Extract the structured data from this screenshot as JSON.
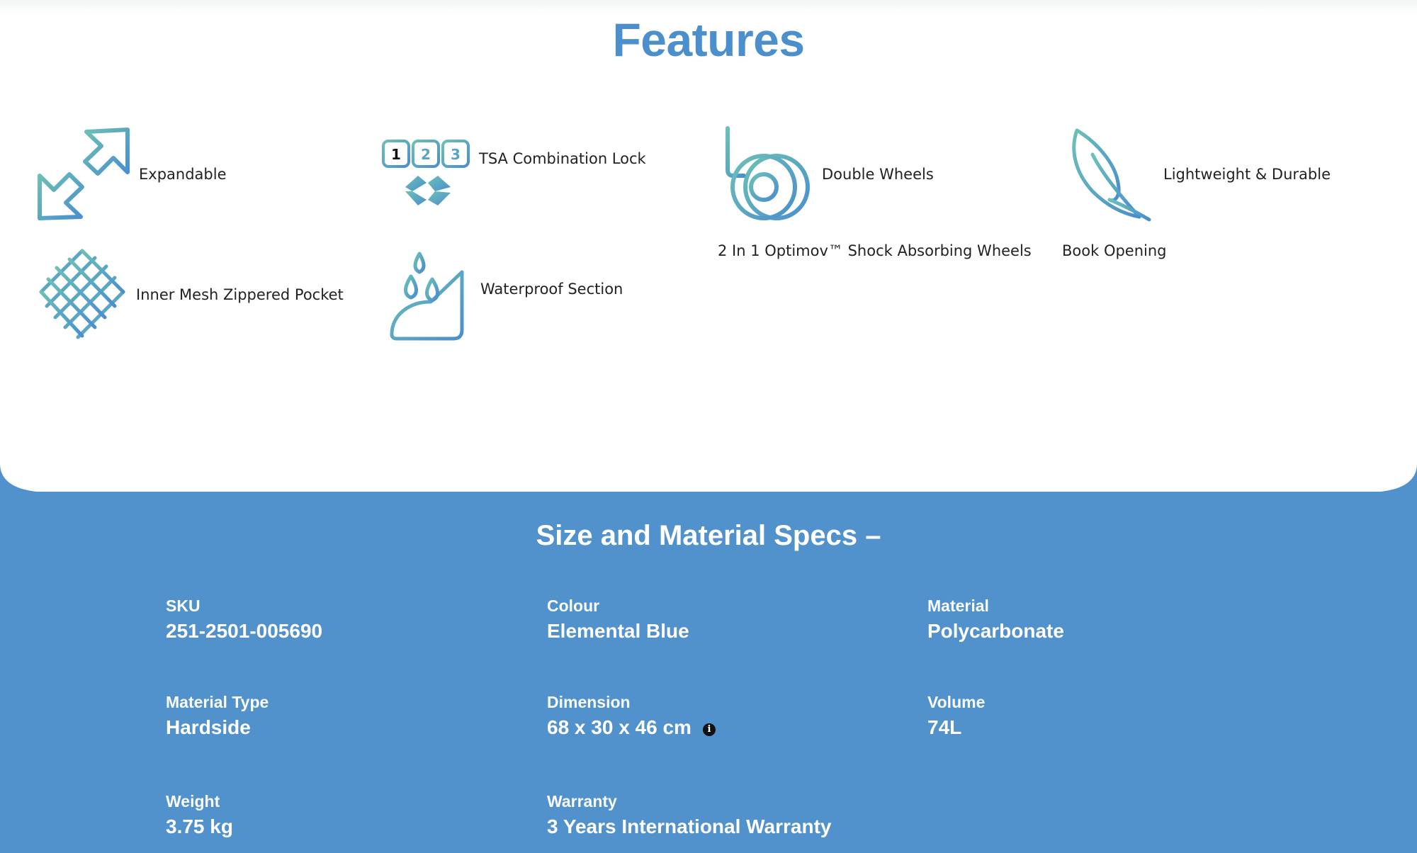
{
  "features": {
    "title": "Features",
    "items": [
      {
        "label": "Expandable",
        "icon": "expand-arrows-icon"
      },
      {
        "label": "TSA Combination Lock",
        "icon": "tsa-lock-icon"
      },
      {
        "label": "Double Wheels",
        "icon": "double-wheels-icon"
      },
      {
        "label": "Lightweight & Durable",
        "icon": "feather-icon"
      },
      {
        "label": "Inner Mesh Zippered Pocket",
        "icon": "mesh-pocket-icon"
      },
      {
        "label": "Waterproof Section",
        "icon": "waterproof-icon"
      }
    ],
    "sub_items": [
      {
        "label": "2 In 1 Optimov™ Shock Absorbing Wheels"
      },
      {
        "label": "Book Opening"
      }
    ],
    "lock_digits": [
      "1",
      "2",
      "3"
    ],
    "icon_gradient": [
      "#62b3b8",
      "#4b8fcd"
    ]
  },
  "specs": {
    "title": "Size and Material Specs –",
    "background": "#5192cc",
    "items": [
      {
        "label": "SKU",
        "value": "251-2501-005690"
      },
      {
        "label": "Colour",
        "value": "Elemental Blue"
      },
      {
        "label": "Material",
        "value": "Polycarbonate"
      },
      {
        "label": "Material Type",
        "value": "Hardside"
      },
      {
        "label": "Dimension",
        "value": "68 x 30 x 46 cm",
        "info": "i"
      },
      {
        "label": "Volume",
        "value": "74L"
      },
      {
        "label": "Weight",
        "value": "3.75 kg"
      },
      {
        "label": "Warranty",
        "value": "3 Years International Warranty"
      }
    ]
  }
}
